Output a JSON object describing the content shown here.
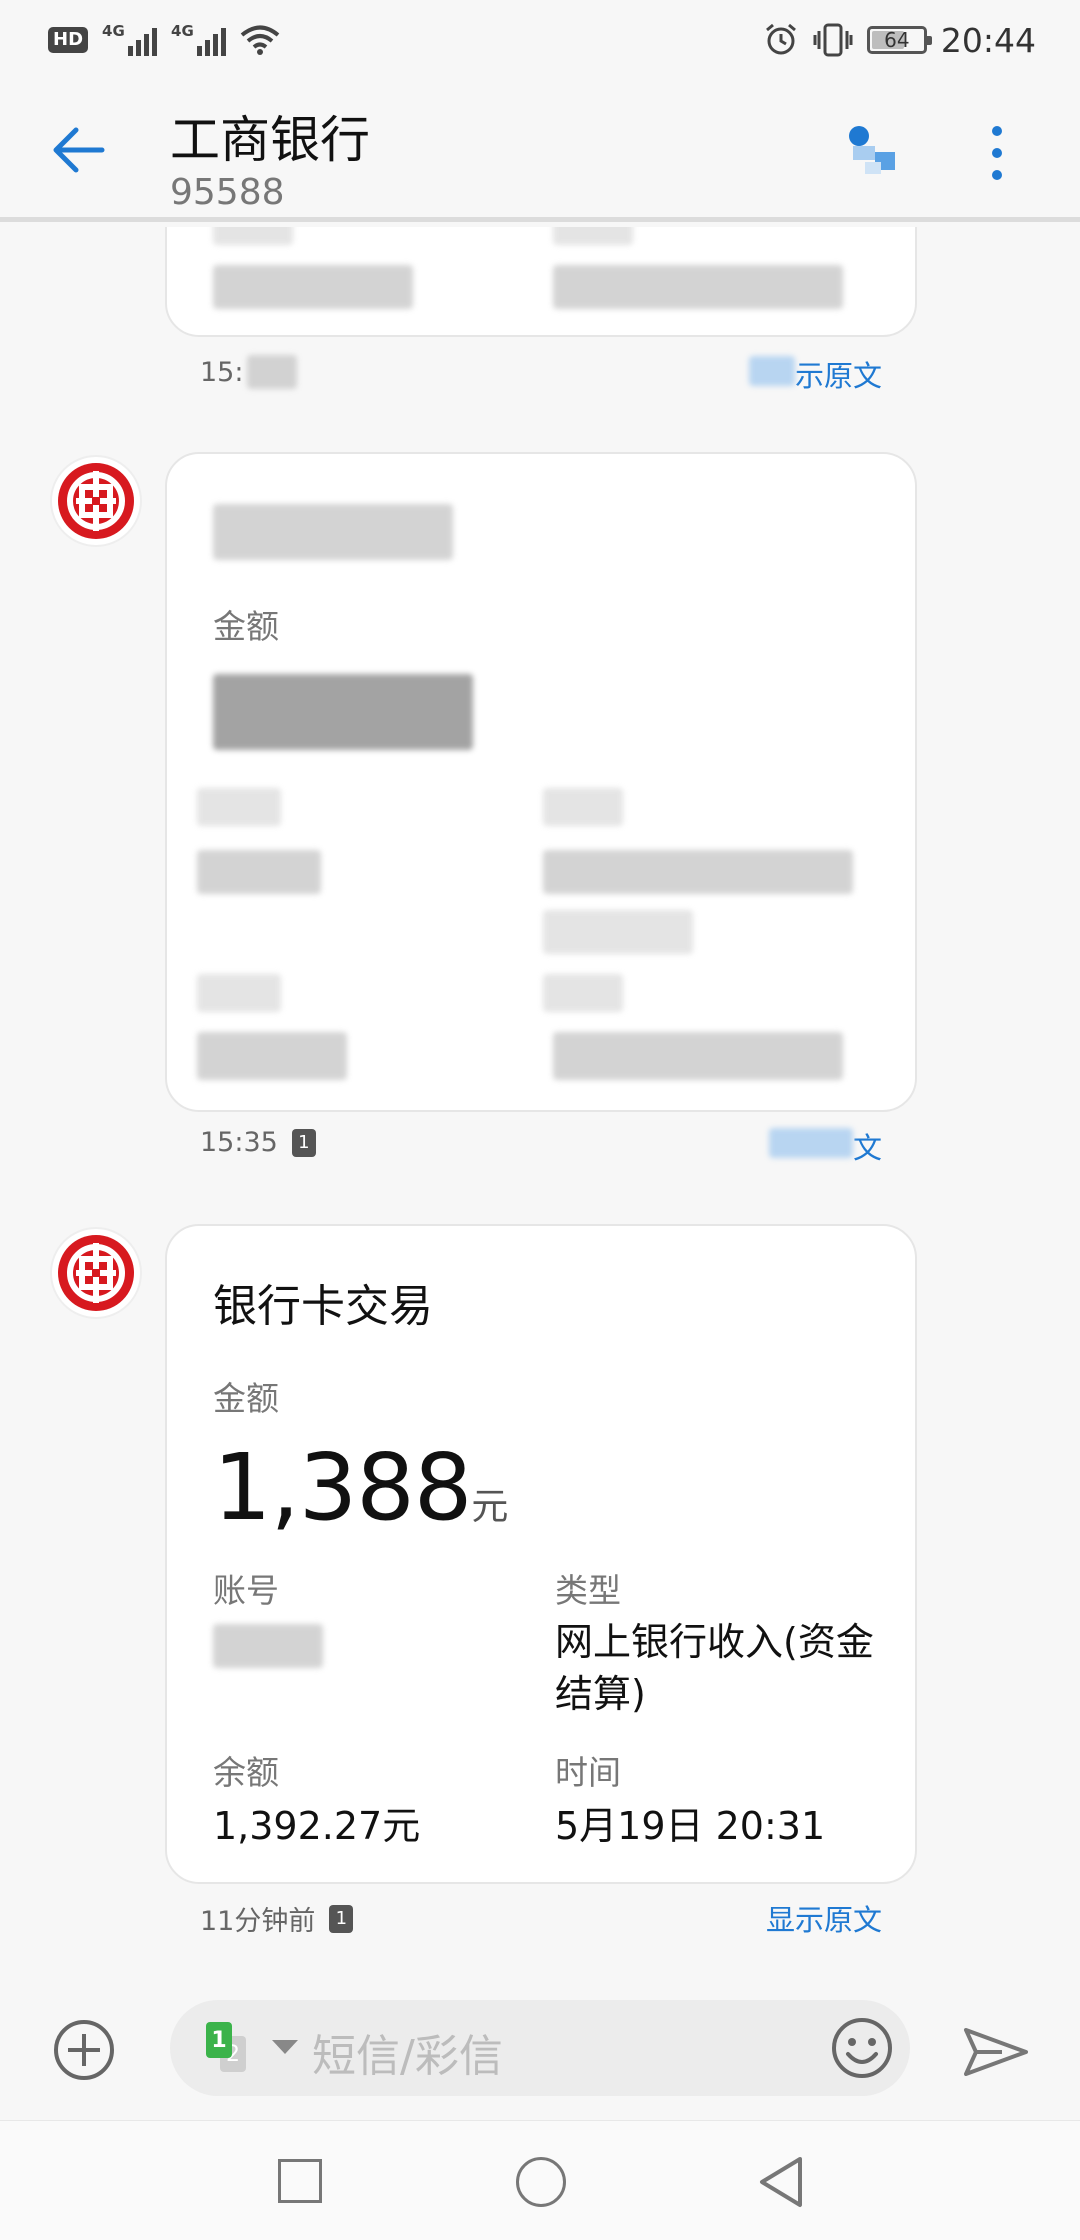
{
  "status_bar": {
    "hd": "HD",
    "network1": "4G",
    "network2": "4G",
    "battery": "64",
    "time": "20:44"
  },
  "header": {
    "title": "工商银行",
    "subtitle": "95588"
  },
  "messages": [
    {
      "time": "15:",
      "show_original": "示原文"
    },
    {
      "label_amount": "金额",
      "time": "15:35",
      "sim": "1",
      "show_original": "文"
    },
    {
      "title": "银行卡交易",
      "label_amount": "金额",
      "amount": "1,388",
      "unit": "元",
      "label_account": "账号",
      "label_type": "类型",
      "type_value": "网上银行收入(资金结算)",
      "label_balance": "余额",
      "balance_value": "1,392.27元",
      "label_time": "时间",
      "time_value": "5月19日 20:31",
      "meta_time": "11分钟前",
      "sim": "1",
      "show_original": "显示原文"
    }
  ],
  "input_bar": {
    "sim1": "1",
    "sim2": "2",
    "placeholder": "短信/彩信"
  },
  "colors": {
    "accent": "#1f79d2",
    "icbc_red": "#d7191f"
  }
}
